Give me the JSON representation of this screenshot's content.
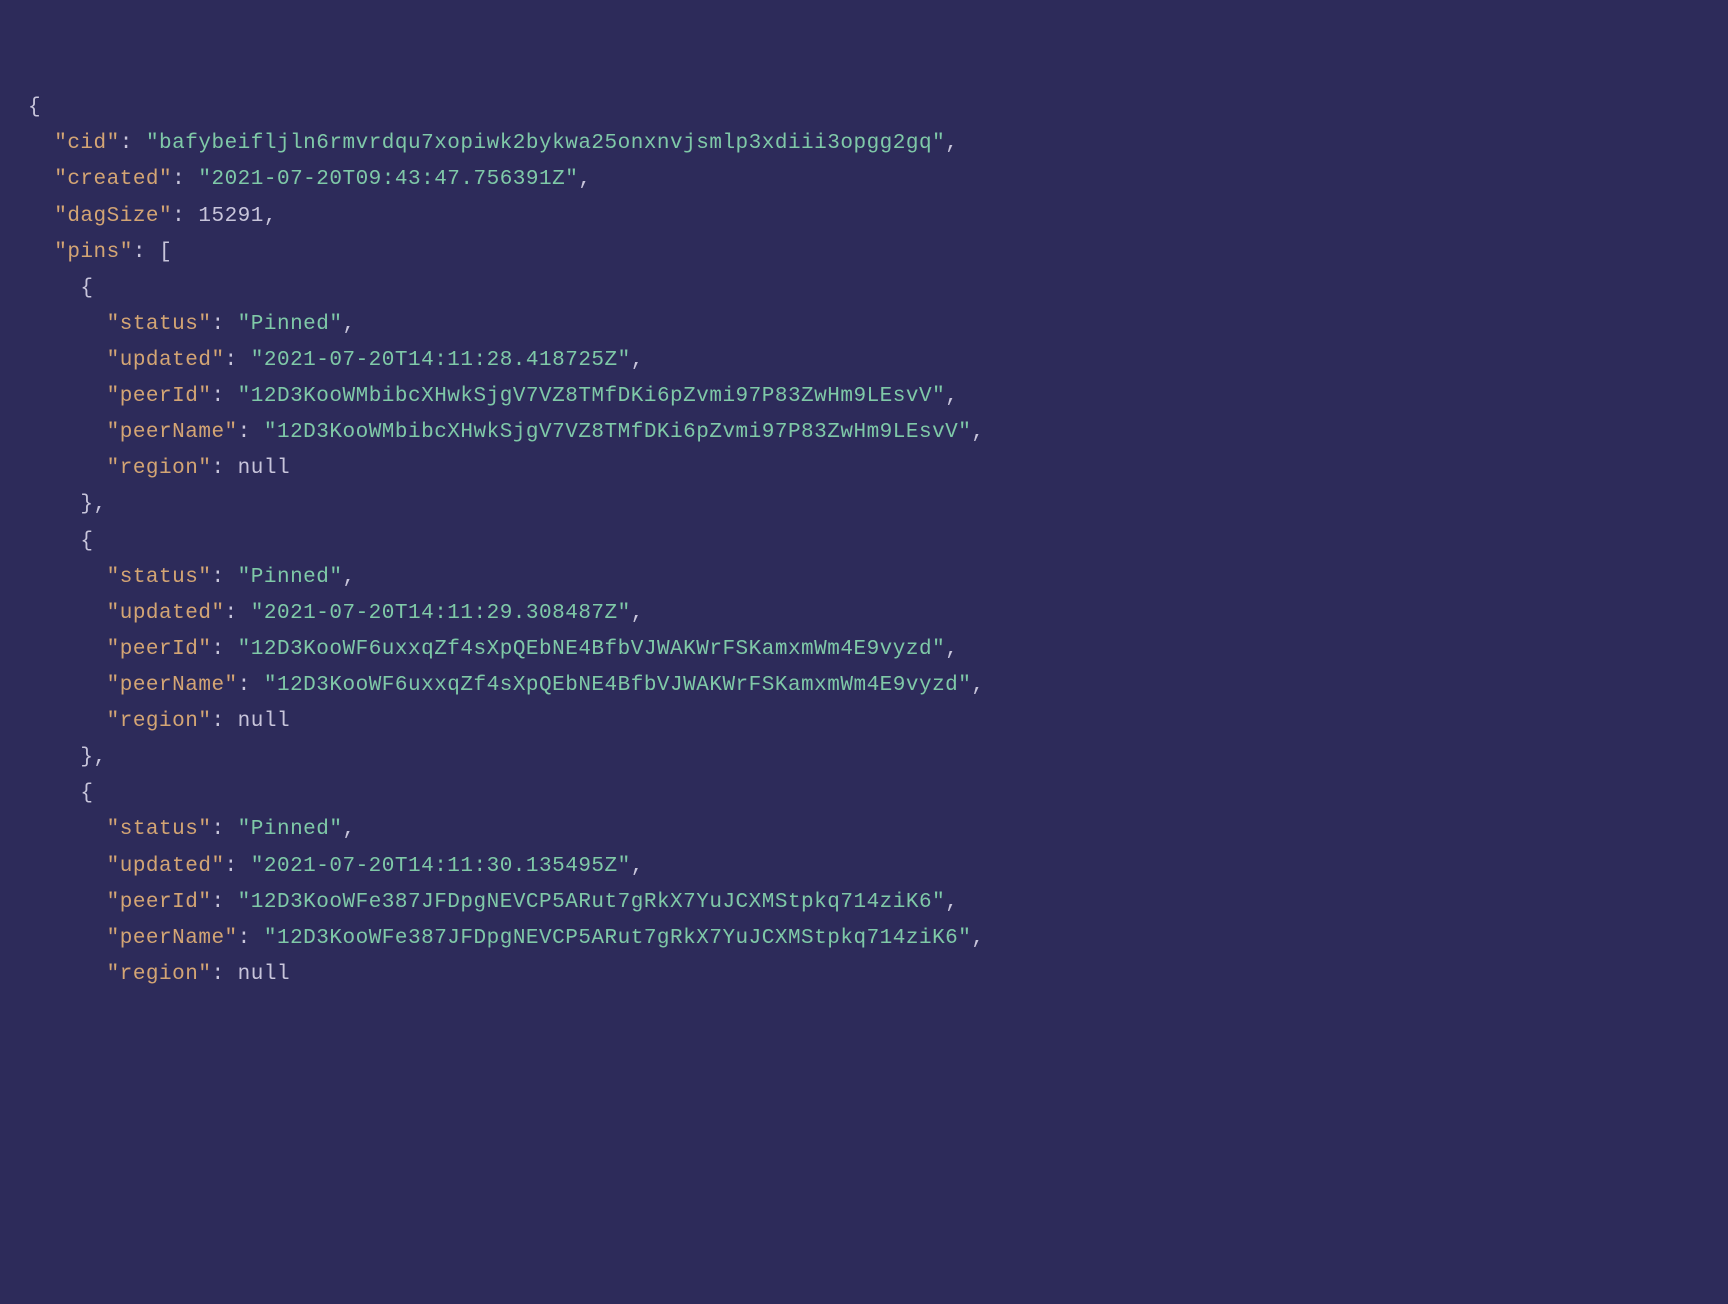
{
  "json_content": {
    "cid_key": "\"cid\"",
    "cid_value": "\"bafybeifljln6rmvrdqu7xopiwk2bykwa25onxnvjsmlp3xdiii3opgg2gq\"",
    "created_key": "\"created\"",
    "created_value": "\"2021-07-20T09:43:47.756391Z\"",
    "dagSize_key": "\"dagSize\"",
    "dagSize_value": "15291",
    "pins_key": "\"pins\"",
    "status_key": "\"status\"",
    "updated_key": "\"updated\"",
    "peerId_key": "\"peerId\"",
    "peerName_key": "\"peerName\"",
    "region_key": "\"region\"",
    "pinned_value": "\"Pinned\"",
    "null_value": "null",
    "pins": [
      {
        "updated": "\"2021-07-20T14:11:28.418725Z\"",
        "peerId": "\"12D3KooWMbibcXHwkSjgV7VZ8TMfDKi6pZvmi97P83ZwHm9LEsvV\"",
        "peerName": "\"12D3KooWMbibcXHwkSjgV7VZ8TMfDKi6pZvmi97P83ZwHm9LEsvV\""
      },
      {
        "updated": "\"2021-07-20T14:11:29.308487Z\"",
        "peerId": "\"12D3KooWF6uxxqZf4sXpQEbNE4BfbVJWAKWrFSKamxmWm4E9vyzd\"",
        "peerName": "\"12D3KooWF6uxxqZf4sXpQEbNE4BfbVJWAKWrFSKamxmWm4E9vyzd\""
      },
      {
        "updated": "\"2021-07-20T14:11:30.135495Z\"",
        "peerId": "\"12D3KooWFe387JFDpgNEVCP5ARut7gRkX7YuJCXMStpkq714ziK6\"",
        "peerName": "\"12D3KooWFe387JFDpgNEVCP5ARut7gRkX7YuJCXMStpkq714ziK6\""
      }
    ]
  }
}
